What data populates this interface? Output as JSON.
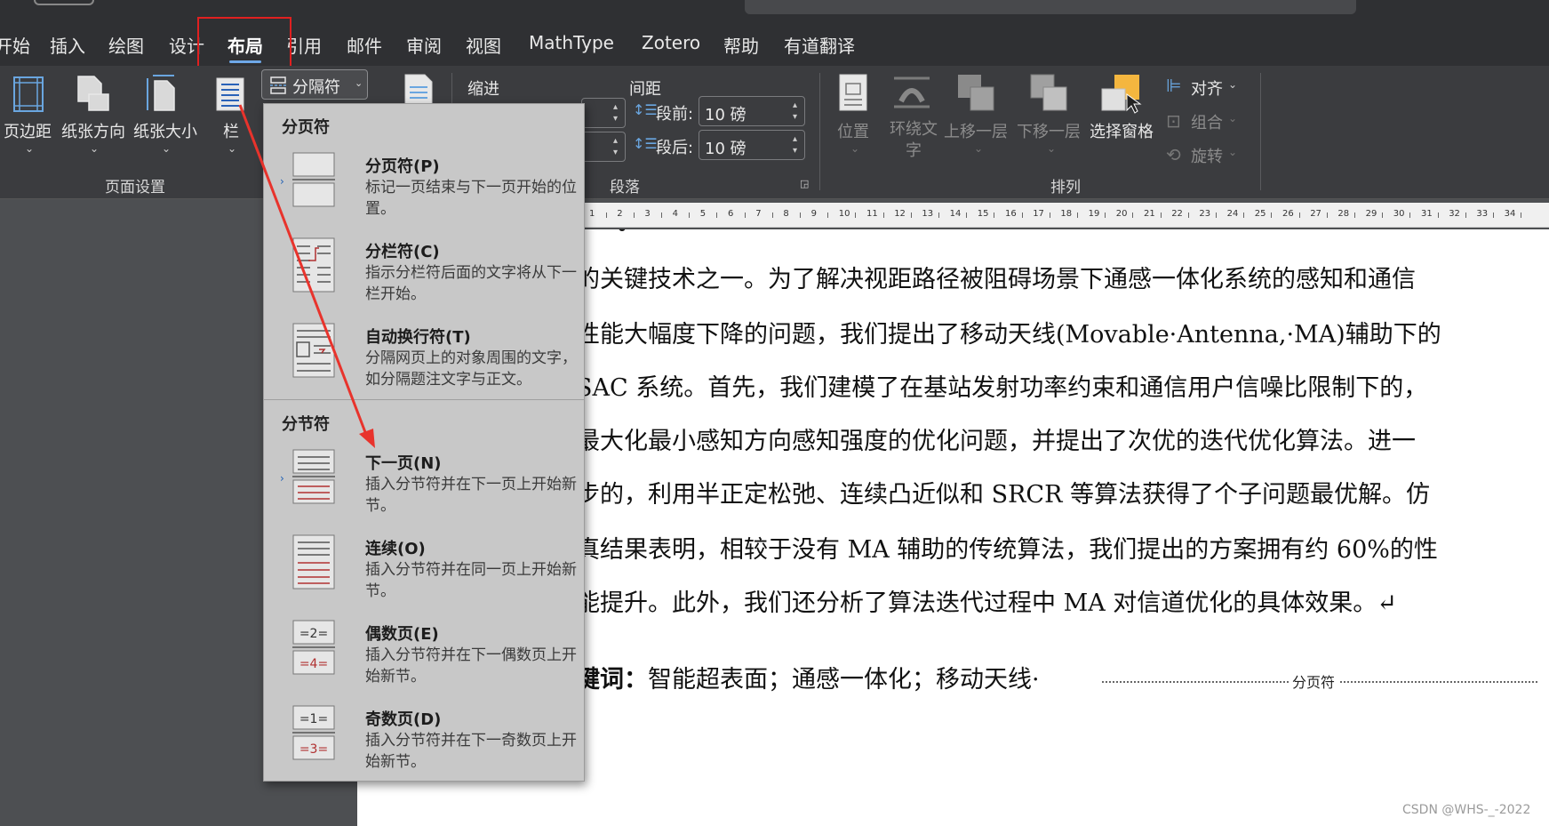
{
  "tabs": [
    {
      "label": "开始",
      "left": 0,
      "shown": "开始"
    },
    {
      "label": "插入"
    },
    {
      "label": "绘图"
    },
    {
      "label": "设计"
    },
    {
      "label": "布局"
    },
    {
      "label": "引用"
    },
    {
      "label": "邮件"
    },
    {
      "label": "审阅"
    },
    {
      "label": "视图"
    },
    {
      "label": "MathType"
    },
    {
      "label": "Zotero"
    },
    {
      "label": "帮助"
    },
    {
      "label": "有道翻译"
    }
  ],
  "ribbon": {
    "margins": "页边距",
    "orientation": "纸张方向",
    "size": "纸张大小",
    "columns": "栏",
    "breaks": "分隔符",
    "page_setup_group": "页面设置",
    "indent": "缩进",
    "spacing": "间距",
    "before_label": "段前:",
    "before_value": "10 磅",
    "after_label": "段后:",
    "after_value": "10 磅",
    "paragraph_group": "段落",
    "position": "位置",
    "wrap_text": "环绕文字",
    "bring_forward": "上移一层",
    "send_backward": "下移一层",
    "selection_pane": "选择窗格",
    "align": "对齐",
    "group": "组合",
    "rotate": "旋转",
    "arrange_group": "排列"
  },
  "ruler_numbers": [
    "1",
    "2",
    "3",
    "4",
    "5",
    "6",
    "7",
    "8",
    "9",
    "10",
    "11",
    "12",
    "13",
    "14",
    "15",
    "16",
    "17",
    "18",
    "19",
    "20",
    "21",
    "22",
    "23",
    "24",
    "25",
    "26",
    "27",
    "28",
    "29",
    "30",
    "31",
    "32",
    "33",
    "34"
  ],
  "menu": {
    "page_breaks_header": "分页符",
    "section_breaks_header": "分节符",
    "page_items": [
      {
        "title": "分页符(P)",
        "desc": "标记一页结束与下一页开始的位置。"
      },
      {
        "title": "分栏符(C)",
        "desc": "指示分栏符后面的文字将从下一栏开始。"
      },
      {
        "title": "自动换行符(T)",
        "desc": "分隔网页上的对象周围的文字，如分隔题注文字与正文。"
      }
    ],
    "section_items": [
      {
        "title": "下一页(N)",
        "desc": "插入分节符并在下一页上开始新节。"
      },
      {
        "title": "连续(O)",
        "desc": "插入分节符并在同一页上开始新节。"
      },
      {
        "title": "偶数页(E)",
        "desc": "插入分节符并在下一偶数页上开始新节。"
      },
      {
        "title": "奇数页(D)",
        "desc": "插入分节符并在下一奇数页上开始新节。"
      }
    ]
  },
  "doc": {
    "lines": [
      "的关键技术之一。为了解决视距路径被阻碍场景下通感一体化系统的感知和通信",
      "性能大幅度下降的问题，我们提出了移动天线(Movable·Antenna,·MA)辅助下的",
      "SAC 系统。首先，我们建模了在基站发射功率约束和通信用户信噪比限制下的，",
      "最大化最小感知方向感知强度的优化问题，并提出了次优的迭代优化算法。进一",
      "步的，利用半正定松弛、连续凸近似和 SRCR 等算法获得了个子问题最优解。仿",
      "真结果表明，相较于没有 MA 辅助的传统算法，我们提出的方案拥有约 60%的性",
      "能提升。此外，我们还分析了算法迭代过程中 MA 对信道优化的具体效果。↵"
    ],
    "keywords_label": "关键词:",
    "keywords_label_shown": "键词：",
    "keywords": "智能超表面；通感一体化；移动天线·",
    "page_break_marker": "分页符"
  },
  "watermark": "CSDN @WHS-_-2022",
  "colors": {
    "highlight": "#e02020",
    "accent": "#6ea8e8"
  }
}
